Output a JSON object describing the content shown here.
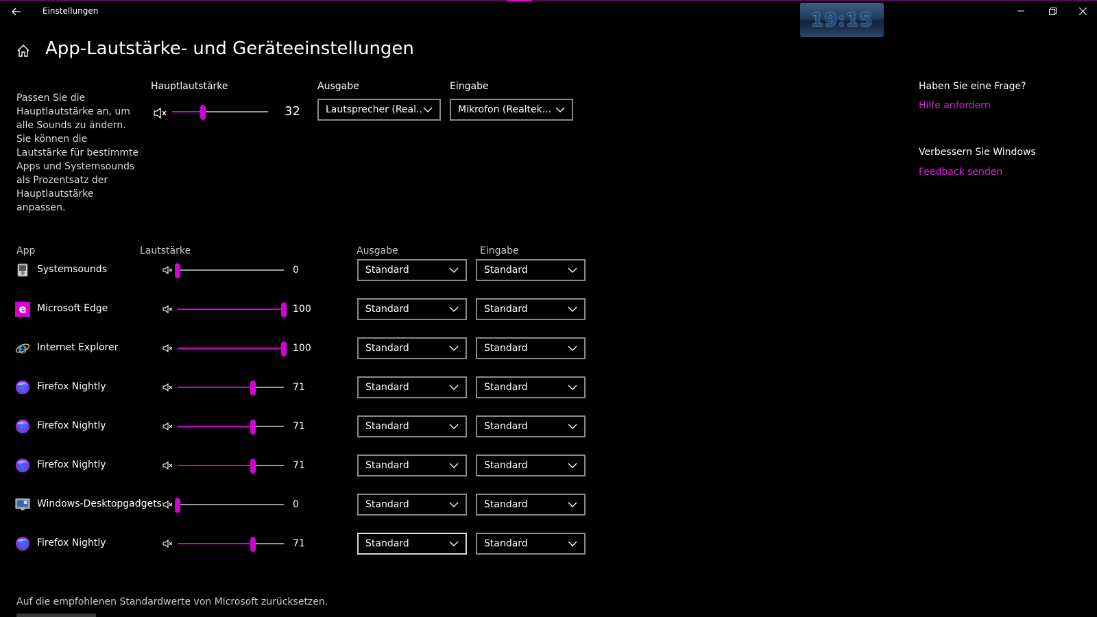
{
  "window": {
    "title": "Einstellungen",
    "clock": "19:15"
  },
  "header": {
    "title": "App-Lautstärke- und Geräteeinstellungen"
  },
  "description": "Passen Sie die Hauptlautstärke an, um alle Sounds zu ändern. Sie können die Lautstärke für bestimmte Apps und Systemsounds als Prozentsatz der Hauptlautstärke anpassen.",
  "master": {
    "label": "Hauptlautstärke",
    "value": 32,
    "output_label": "Ausgabe",
    "output_value": "Lautsprecher (Real...",
    "input_label": "Eingabe",
    "input_value": "Mikrofon (Realtek..."
  },
  "table": {
    "col_app": "App",
    "col_volume": "Lautstärke",
    "col_output": "Ausgabe",
    "col_input": "Eingabe"
  },
  "apps": [
    {
      "name": "Systemsounds",
      "icon": "system-sounds-icon",
      "volume": 0,
      "output": "Standard",
      "input": "Standard"
    },
    {
      "name": "Microsoft Edge",
      "icon": "edge-icon",
      "volume": 100,
      "output": "Standard",
      "input": "Standard"
    },
    {
      "name": "Internet Explorer",
      "icon": "internet-explorer-icon",
      "volume": 100,
      "output": "Standard",
      "input": "Standard"
    },
    {
      "name": "Firefox Nightly",
      "icon": "firefox-nightly-icon",
      "volume": 71,
      "output": "Standard",
      "input": "Standard"
    },
    {
      "name": "Firefox Nightly",
      "icon": "firefox-nightly-icon",
      "volume": 71,
      "output": "Standard",
      "input": "Standard"
    },
    {
      "name": "Firefox Nightly",
      "icon": "firefox-nightly-icon",
      "volume": 71,
      "output": "Standard",
      "input": "Standard"
    },
    {
      "name": "Windows-Desktopgadgets",
      "icon": "desktop-gadgets-icon",
      "volume": 0,
      "output": "Standard",
      "input": "Standard"
    },
    {
      "name": "Firefox Nightly",
      "icon": "firefox-nightly-icon",
      "volume": 71,
      "output": "Standard",
      "input": "Standard"
    }
  ],
  "sidebar": {
    "question_title": "Haben Sie eine Frage?",
    "help_link": "Hilfe anfordern",
    "improve_title": "Verbessern Sie Windows",
    "feedback_link": "Feedback senden"
  },
  "reset": {
    "text": "Auf die empfohlenen Standardwerte von Microsoft zurücksetzen."
  },
  "colors": {
    "accent": "#d600d6",
    "link": "#e020e0",
    "background": "#000000"
  }
}
